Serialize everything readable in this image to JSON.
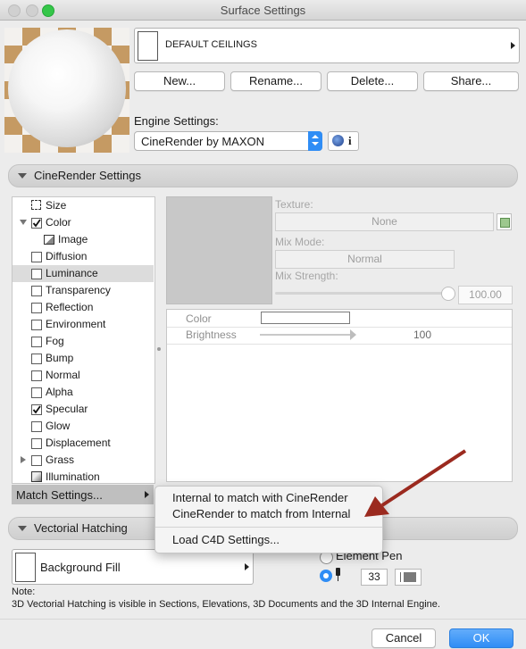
{
  "window": {
    "title": "Surface Settings"
  },
  "surface": {
    "name": "DEFAULT CEILINGS"
  },
  "buttons": {
    "new": "New...",
    "rename": "Rename...",
    "delete": "Delete...",
    "share": "Share..."
  },
  "engine": {
    "label": "Engine Settings:",
    "selected": "CineRender by MAXON",
    "info_glyph": "i"
  },
  "cinerender_section": {
    "title": "CineRender Settings"
  },
  "channels": [
    {
      "label": "Size",
      "checked": null
    },
    {
      "label": "Color",
      "checked": true
    },
    {
      "label": "Image",
      "checked": null
    },
    {
      "label": "Diffusion",
      "checked": false
    },
    {
      "label": "Luminance",
      "checked": false,
      "selected": true
    },
    {
      "label": "Transparency",
      "checked": false
    },
    {
      "label": "Reflection",
      "checked": false
    },
    {
      "label": "Environment",
      "checked": false
    },
    {
      "label": "Fog",
      "checked": false
    },
    {
      "label": "Bump",
      "checked": false
    },
    {
      "label": "Normal",
      "checked": false
    },
    {
      "label": "Alpha",
      "checked": false
    },
    {
      "label": "Specular",
      "checked": true
    },
    {
      "label": "Glow",
      "checked": false
    },
    {
      "label": "Displacement",
      "checked": false
    },
    {
      "label": "Grass",
      "checked": false
    },
    {
      "label": "Illumination",
      "checked": null
    }
  ],
  "texture_panel": {
    "texture_label": "Texture:",
    "texture_value": "None",
    "mix_mode_label": "Mix Mode:",
    "mix_mode_value": "Normal",
    "mix_strength_label": "Mix Strength:",
    "mix_strength_value": "100.00",
    "color_label": "Color",
    "brightness_label": "Brightness",
    "brightness_value": "100"
  },
  "match_settings": {
    "label": "Match Settings...",
    "menu": [
      "Internal to match with CineRender",
      "CineRender to match from Internal",
      "Load C4D Settings..."
    ]
  },
  "vectorial_section": {
    "title": "Vectorial Hatching"
  },
  "fill": {
    "label": "Background Fill"
  },
  "pen": {
    "element_pen_label": "Element Pen",
    "pen_number": "33"
  },
  "note": {
    "title": "Note:",
    "text": "3D Vectorial Hatching is visible in Sections, Elevations, 3D Documents and the 3D Internal Engine."
  },
  "footer": {
    "cancel": "Cancel",
    "ok": "OK"
  },
  "colors": {
    "accent": "#2f8df5",
    "arrow": "#9b2a1f"
  }
}
